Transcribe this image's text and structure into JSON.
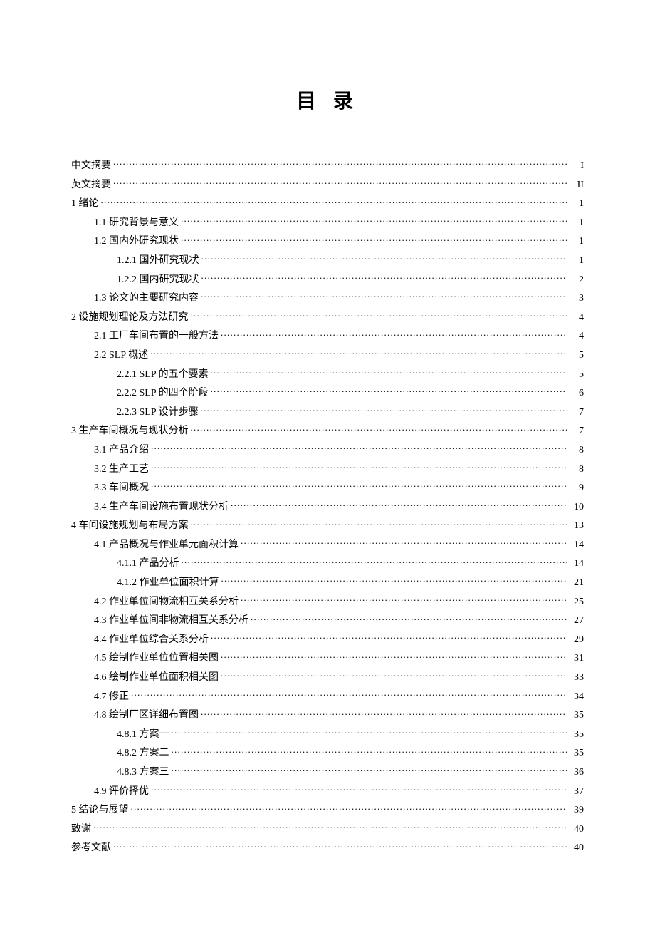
{
  "title": "目 录",
  "toc": [
    {
      "indent": 0,
      "label": "中文摘要",
      "page": "I"
    },
    {
      "indent": 0,
      "label": "英文摘要",
      "page": "II"
    },
    {
      "indent": 0,
      "label": "1 绪论",
      "page": "1"
    },
    {
      "indent": 1,
      "label": "1.1 研究背景与意义",
      "page": "1"
    },
    {
      "indent": 1,
      "label": "1.2 国内外研究现状",
      "page": "1"
    },
    {
      "indent": 2,
      "label": "1.2.1 国外研究现状",
      "page": "1"
    },
    {
      "indent": 2,
      "label": "1.2.2 国内研究现状",
      "page": "2"
    },
    {
      "indent": 1,
      "label": "1.3 论文的主要研究内容",
      "page": "3"
    },
    {
      "indent": 0,
      "label": "2 设施规划理论及方法研究",
      "page": "4"
    },
    {
      "indent": 1,
      "label": "2.1 工厂车间布置的一般方法",
      "page": "4"
    },
    {
      "indent": 1,
      "label": "2.2 SLP 概述",
      "page": "5"
    },
    {
      "indent": 2,
      "label": "2.2.1 SLP 的五个要素",
      "page": "5"
    },
    {
      "indent": 2,
      "label": "2.2.2 SLP 的四个阶段",
      "page": "6"
    },
    {
      "indent": 2,
      "label": "2.2.3 SLP 设计步骤",
      "page": "7"
    },
    {
      "indent": 0,
      "label": "3 生产车间概况与现状分析",
      "page": "7"
    },
    {
      "indent": 1,
      "label": "3.1 产品介绍",
      "page": "8"
    },
    {
      "indent": 1,
      "label": "3.2 生产工艺",
      "page": "8"
    },
    {
      "indent": 1,
      "label": "3.3 车间概况",
      "page": "9"
    },
    {
      "indent": 1,
      "label": "3.4 生产车间设施布置现状分析",
      "page": "10"
    },
    {
      "indent": 0,
      "label": "4 车间设施规划与布局方案",
      "page": "13"
    },
    {
      "indent": 1,
      "label": "4.1 产品概况与作业单元面积计算",
      "page": "14"
    },
    {
      "indent": 2,
      "label": "4.1.1 产品分析",
      "page": "14"
    },
    {
      "indent": 2,
      "label": "4.1.2 作业单位面积计算",
      "page": "21"
    },
    {
      "indent": 1,
      "label": "4.2 作业单位间物流相互关系分析",
      "page": "25"
    },
    {
      "indent": 1,
      "label": "4.3 作业单位间非物流相互关系分析",
      "page": "27"
    },
    {
      "indent": 1,
      "label": "4.4 作业单位综合关系分析",
      "page": "29"
    },
    {
      "indent": 1,
      "label": "4.5 绘制作业单位位置相关图",
      "page": "31"
    },
    {
      "indent": 1,
      "label": "4.6 绘制作业单位面积相关图",
      "page": "33"
    },
    {
      "indent": 1,
      "label": "4.7 修正",
      "page": "34"
    },
    {
      "indent": 1,
      "label": "4.8 绘制厂区详细布置图",
      "page": "35"
    },
    {
      "indent": 2,
      "label": "4.8.1 方案一",
      "page": "35"
    },
    {
      "indent": 2,
      "label": "4.8.2 方案二",
      "page": "35"
    },
    {
      "indent": 2,
      "label": "4.8.3 方案三",
      "page": "36"
    },
    {
      "indent": 1,
      "label": "4.9 评价择优",
      "page": "37"
    },
    {
      "indent": 0,
      "label": "5 结论与展望",
      "page": "39"
    },
    {
      "indent": 0,
      "label": "致谢",
      "page": "40"
    },
    {
      "indent": 0,
      "label": "参考文献",
      "page": "40"
    }
  ]
}
